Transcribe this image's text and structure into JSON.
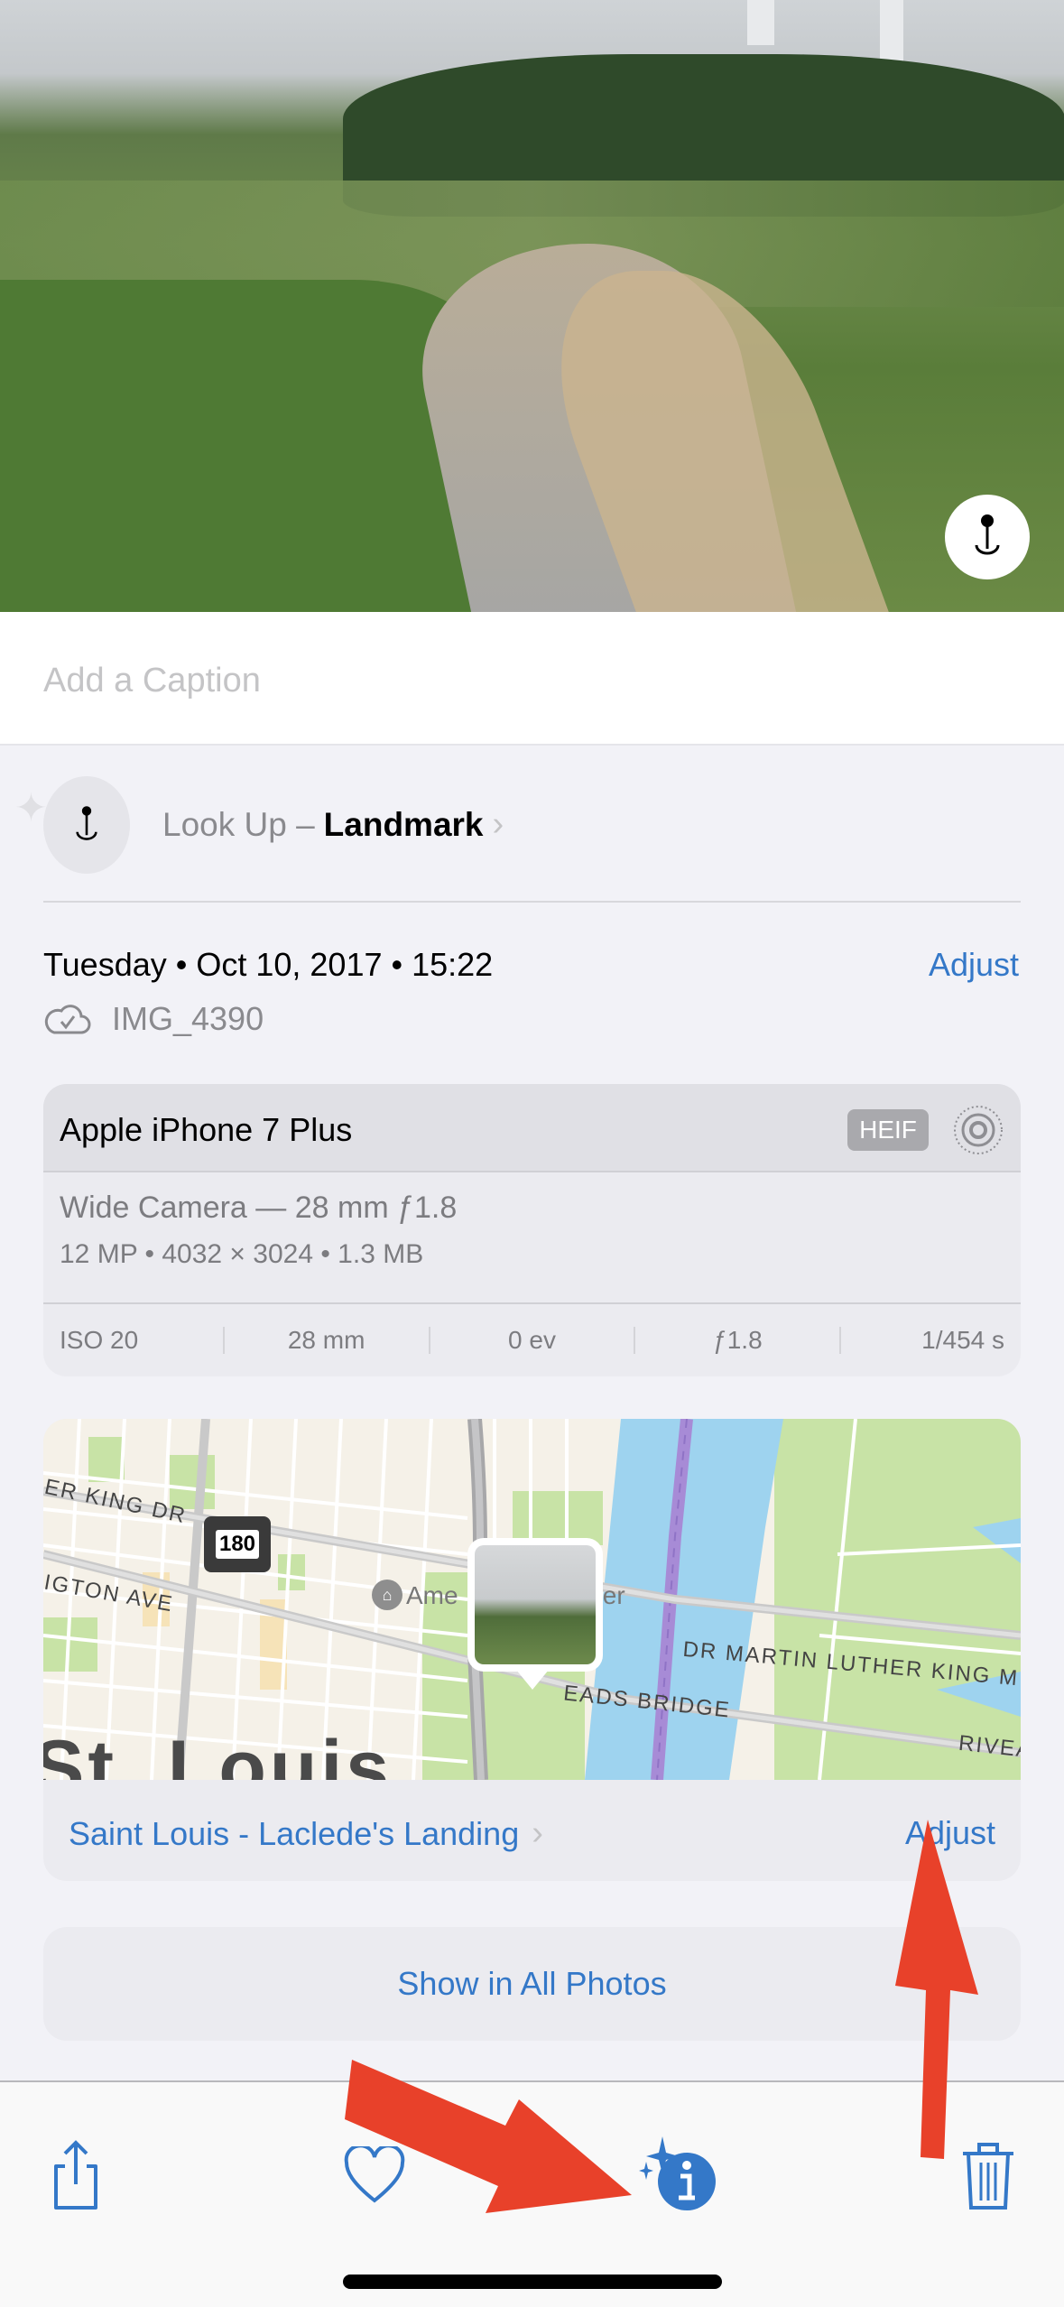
{
  "photo": {
    "description": "Park landscape with winding path",
    "visual_lookup_button_icon": "landmark-lookup-icon"
  },
  "caption": {
    "placeholder": "Add a Caption",
    "value": ""
  },
  "lookup": {
    "prefix": "Look Up –",
    "category": "Landmark",
    "icon": "landmark-pin-icon",
    "chevron": "›"
  },
  "info": {
    "date": "Tuesday • Oct 10, 2017 • 15:22",
    "adjust_label": "Adjust",
    "filename": "IMG_4390",
    "cloud_icon": "icloud-check-icon"
  },
  "camera": {
    "model": "Apple iPhone 7 Plus",
    "format_badge": "HEIF",
    "live_icon": "live-photo-icon",
    "lens": "Wide Camera — 28 mm ƒ1.8",
    "specs": "12 MP  •  4032 × 3024  •  1.3 MB",
    "exif": [
      {
        "name": "iso",
        "value": "ISO 20"
      },
      {
        "name": "focal-length",
        "value": "28 mm"
      },
      {
        "name": "exposure",
        "value": "0 ev"
      },
      {
        "name": "aperture",
        "value": "ƒ1.8"
      },
      {
        "name": "shutter",
        "value": "1/454 s"
      }
    ]
  },
  "map": {
    "labels": {
      "mlk_dr": "ER KING DR",
      "washington": "IGTON AVE",
      "museum": "Ame",
      "museum2": "ter",
      "mlk_bridge": "DR MARTIN LUTHER KING M",
      "eads": "EADS BRIDGE",
      "riverfront": "RIVEA",
      "city": "St. Louis",
      "highway": "180"
    },
    "location_name": "Saint Louis - Laclede's Landing",
    "chevron": "›",
    "adjust_label": "Adjust"
  },
  "show_all_label": "Show in All Photos",
  "toolbar": {
    "share_icon": "share-icon",
    "favorite_icon": "heart-icon",
    "info_icon": "info-sparkle-icon",
    "delete_icon": "trash-icon"
  },
  "colors": {
    "accent": "#3478c8",
    "annotation_arrow": "#e8412a"
  }
}
